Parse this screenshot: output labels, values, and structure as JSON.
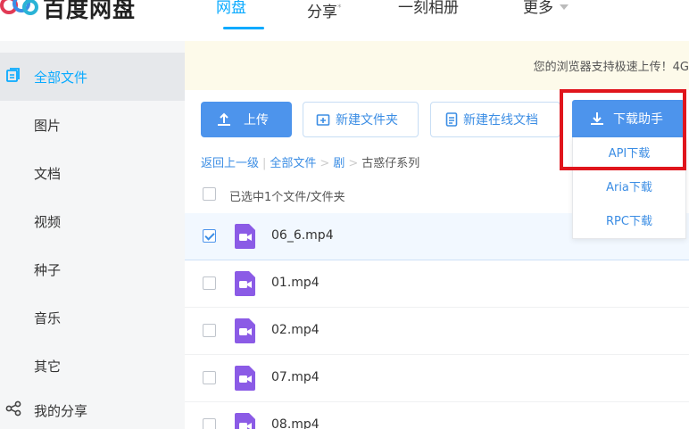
{
  "header": {
    "logo_text": "百度网盘",
    "nav": [
      {
        "label": "网盘",
        "active": true
      },
      {
        "label": "分享"
      },
      {
        "label": "一刻相册"
      },
      {
        "label": "更多"
      }
    ]
  },
  "sidebar": {
    "items": [
      {
        "label": "全部文件",
        "active": true,
        "icon": "file-stack-icon"
      },
      {
        "label": "图片"
      },
      {
        "label": "文档"
      },
      {
        "label": "视频"
      },
      {
        "label": "种子"
      },
      {
        "label": "音乐"
      },
      {
        "label": "其它"
      },
      {
        "label": "我的分享",
        "icon": "share-icon"
      }
    ]
  },
  "notice": {
    "text": "您的浏览器支持极速上传！4G"
  },
  "toolbar": {
    "upload_label": "上传",
    "new_folder_label": "新建文件夹",
    "new_doc_label": "新建在线文档",
    "download_helper_label": "下载助手"
  },
  "download_menu": {
    "items": [
      "API下载",
      "Aria下载",
      "RPC下载"
    ]
  },
  "breadcrumb": {
    "back": "返回上一级",
    "all_files": "全部文件",
    "folder": "剧",
    "current": "古惑仔系列"
  },
  "selection": {
    "text": "已选中1个文件/文件夹"
  },
  "files": [
    {
      "name": "06_6.mp4",
      "checked": true
    },
    {
      "name": "01.mp4",
      "checked": false
    },
    {
      "name": "02.mp4",
      "checked": false
    },
    {
      "name": "07.mp4",
      "checked": false
    },
    {
      "name": "08.mp4",
      "checked": false
    }
  ],
  "colors": {
    "accent": "#09aaff",
    "button_blue": "#4d94ec",
    "video_icon": "#8b5be6",
    "highlight": "#e0151c"
  }
}
